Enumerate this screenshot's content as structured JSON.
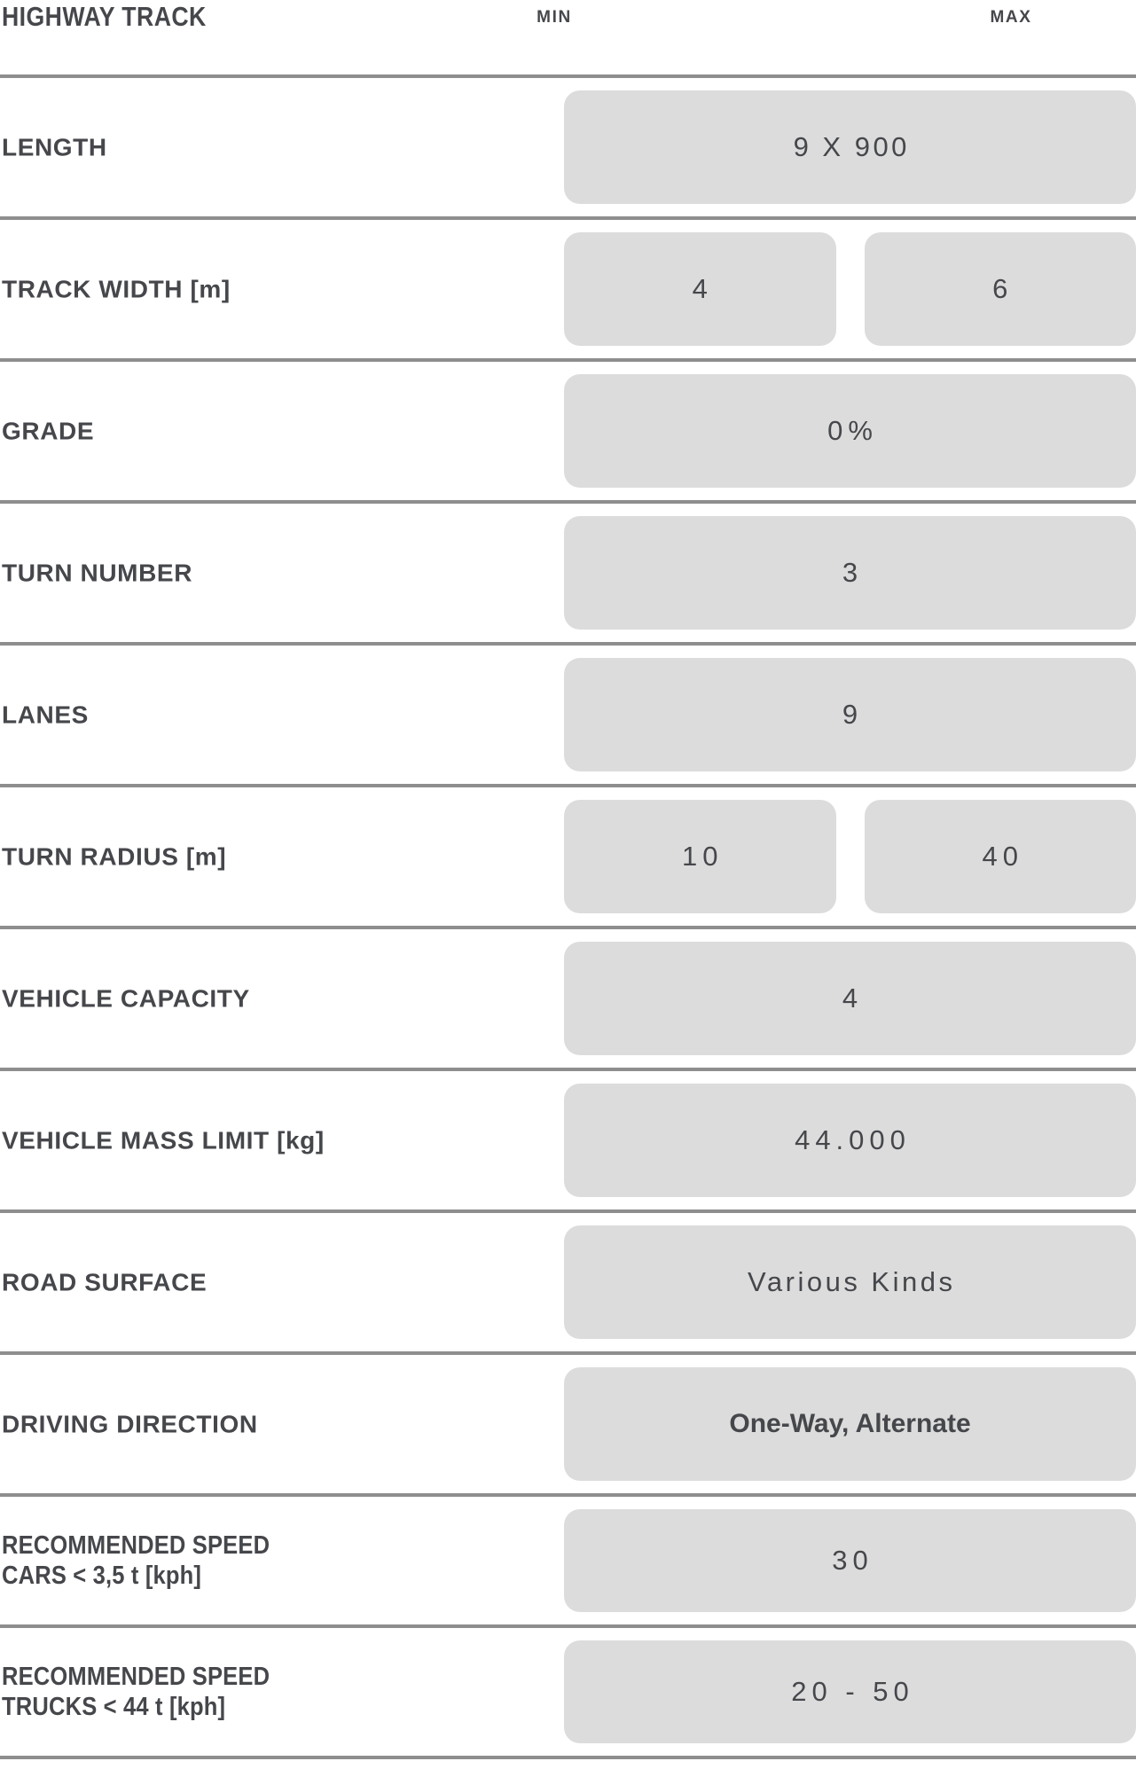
{
  "header": {
    "title": "HIGHWAY TRACK",
    "col_min": "MIN",
    "col_max": "MAX"
  },
  "colors": {
    "text": "#45474b",
    "pill_bg": "#dcdcdc",
    "divider": "#8e8e8e",
    "page_bg": "#ffffff"
  },
  "rows": [
    {
      "label": "LENGTH",
      "span": true,
      "value": "9 X 900",
      "min": "",
      "max": ""
    },
    {
      "label": "TRACK WIDTH [m]",
      "span": false,
      "value": "",
      "min": "4",
      "max": "6"
    },
    {
      "label": "GRADE",
      "span": true,
      "value": "0%",
      "min": "",
      "max": ""
    },
    {
      "label": "TURN NUMBER",
      "span": true,
      "value": "3",
      "min": "",
      "max": ""
    },
    {
      "label": "LANES",
      "span": true,
      "value": "9",
      "min": "",
      "max": ""
    },
    {
      "label": "TURN RADIUS [m]",
      "span": false,
      "value": "",
      "min": "10",
      "max": "40"
    },
    {
      "label": "VEHICLE CAPACITY",
      "span": true,
      "value": "4",
      "min": "",
      "max": ""
    },
    {
      "label": "VEHICLE MASS LIMIT [kg]",
      "span": true,
      "value": "44.000",
      "min": "",
      "max": ""
    },
    {
      "label": "ROAD SURFACE",
      "span": true,
      "value": "Various Kinds",
      "min": "",
      "max": ""
    },
    {
      "label": "DRIVING DIRECTION",
      "span": true,
      "value": "One-Way, Alternate",
      "min": "",
      "max": ""
    },
    {
      "label": "RECOMMENDED SPEED\nCARS < 3,5 t [kph]",
      "span": true,
      "value": "30",
      "min": "",
      "max": ""
    },
    {
      "label": "RECOMMENDED SPEED\nTRUCKS < 44 t [kph]",
      "span": true,
      "value": "20 - 50",
      "min": "",
      "max": ""
    }
  ]
}
